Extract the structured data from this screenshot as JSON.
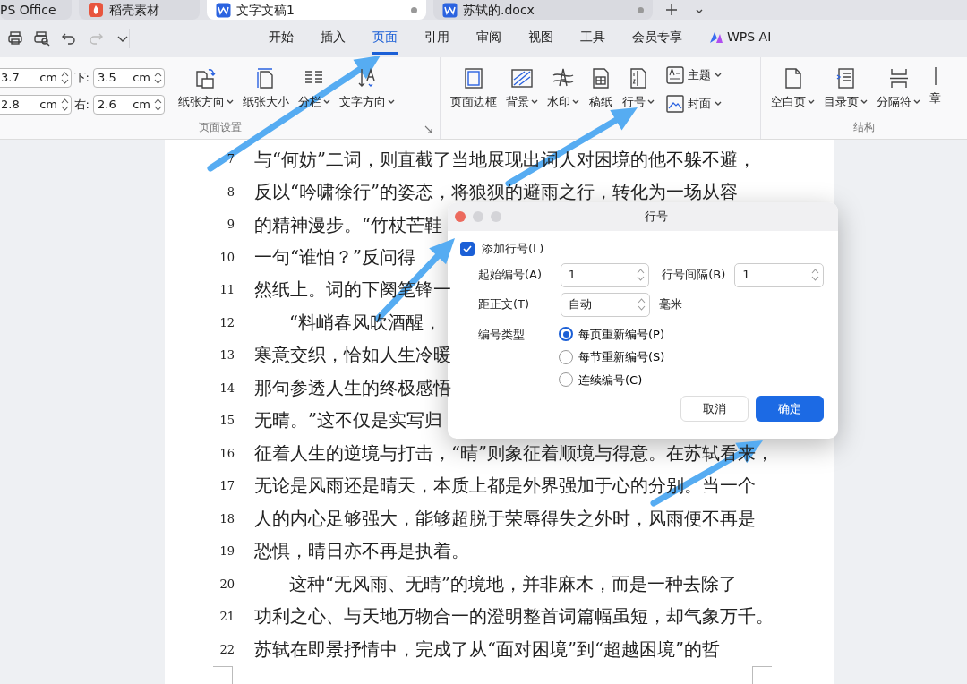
{
  "tabs": [
    {
      "label": "PS Office",
      "selected": false,
      "kind": "home",
      "modified": false
    },
    {
      "label": "稻壳素材",
      "selected": false,
      "kind": "docer",
      "modified": false
    },
    {
      "label": "文字文稿1",
      "selected": true,
      "kind": "doc",
      "modified": true
    },
    {
      "label": "苏轼的.docx",
      "selected": false,
      "kind": "doc",
      "modified": true
    }
  ],
  "quick_access": [
    {
      "kind": "print",
      "disabled": false
    },
    {
      "kind": "preview",
      "disabled": false
    },
    {
      "kind": "undo",
      "disabled": false
    },
    {
      "kind": "redo",
      "disabled": true
    },
    {
      "kind": "more",
      "disabled": false
    }
  ],
  "menu": [
    {
      "label": "开始",
      "selected": false
    },
    {
      "label": "插入",
      "selected": false
    },
    {
      "label": "页面",
      "selected": true
    },
    {
      "label": "引用",
      "selected": false
    },
    {
      "label": "审阅",
      "selected": false
    },
    {
      "label": "视图",
      "selected": false
    },
    {
      "label": "工具",
      "selected": false
    },
    {
      "label": "会员专享",
      "selected": false
    },
    {
      "label": "WPS AI",
      "selected": false,
      "kind": "ai"
    }
  ],
  "margins": [
    {
      "value": "3.7",
      "unit": "cm"
    },
    {
      "label": "下:",
      "value": "3.5",
      "unit": "cm"
    },
    {
      "value": "2.8",
      "unit": "cm"
    },
    {
      "label": "右:",
      "value": "2.6",
      "unit": "cm"
    }
  ],
  "ribbon_groups": [
    {
      "label": "页面设置",
      "launcher": true,
      "items": [
        {
          "label": "纸张方向",
          "dropdown": true
        },
        {
          "label": "纸张大小",
          "dropdown": false
        },
        {
          "label": "分栏",
          "dropdown": true
        },
        {
          "label": "文字方向",
          "dropdown": true
        }
      ]
    },
    {
      "items": [
        {
          "label": "页面边框",
          "dropdown": false
        },
        {
          "label": "背景",
          "dropdown": true
        },
        {
          "label": "水印",
          "dropdown": true
        },
        {
          "label": "稿纸",
          "dropdown": false
        },
        {
          "label": "行号",
          "dropdown": true
        },
        {
          "kind": "small",
          "label": "主题",
          "dropdown": true
        },
        {
          "kind": "small",
          "label": "封面",
          "dropdown": true
        }
      ]
    },
    {
      "label": "结构",
      "launcher": false,
      "items": [
        {
          "label": "空白页",
          "dropdown": true
        },
        {
          "label": "目录页",
          "dropdown": true
        },
        {
          "label": "分隔符",
          "dropdown": true
        },
        {
          "label": "章",
          "dropdown": false
        }
      ]
    }
  ],
  "document": {
    "lines": [
      {
        "number": "7",
        "text": "与“何妨”二词，则直截了当地展现出词人对困境的他不躲不避，",
        "indent": false
      },
      {
        "number": "8",
        "text": "反以“吟啸徐行”的姿态，将狼狈的避雨之行，转化为一场从容",
        "indent": false
      },
      {
        "number": "9",
        "text": "的精神漫步。“竹杖芒鞋",
        "indent": false
      },
      {
        "number": "10",
        "text": "一句“谁怕？”反问得",
        "indent": false
      },
      {
        "number": "11",
        "text": "然纸上。词的下阕笔锋一",
        "indent": false
      },
      {
        "number": "12",
        "text": "“料峭春风吹酒醒，",
        "indent": true
      },
      {
        "number": "13",
        "text": "寒意交织，恰如人生冷暖",
        "indent": false
      },
      {
        "number": "14",
        "text": "那句参透人生的终极感悟",
        "indent": false
      },
      {
        "number": "15",
        "text": "无晴。”这不仅是实写归",
        "indent": false
      },
      {
        "number": "16",
        "text": "征着人生的逆境与打击，“晴”则象征着顺境与得意。在苏轼看来，",
        "indent": false
      },
      {
        "number": "17",
        "text": "无论是风雨还是晴天，本质上都是外界强加于心的分别。当一个",
        "indent": false
      },
      {
        "number": "18",
        "text": "人的内心足够强大，能够超脱于荣辱得失之外时，风雨便不再是",
        "indent": false
      },
      {
        "number": "19",
        "text": "恐惧，晴日亦不再是执着。",
        "indent": false
      },
      {
        "number": "20",
        "text": "这种“无风雨、无晴”的境地，并非麻木，而是一种去除了",
        "indent": true
      },
      {
        "number": "21",
        "text": "功利之心、与天地万物合一的澄明整首词篇幅虽短，却气象万千。",
        "indent": false
      },
      {
        "number": "22",
        "text": "苏轼在即景抒情中，完成了从“面对困境”到“超越困境”的哲",
        "indent": false
      }
    ]
  },
  "dialog": {
    "title": "行号",
    "add_line_numbers": {
      "label": "添加行号(L)",
      "checked": true
    },
    "start": {
      "label": "起始编号(A)",
      "value": "1"
    },
    "interval": {
      "label": "行号间隔(B)",
      "value": "1"
    },
    "distance": {
      "label": "距正文(T)",
      "value": "自动",
      "unit": "毫米"
    },
    "numbering": {
      "label": "编号类型",
      "options": [
        {
          "label": "每页重新编号(P)",
          "selected": true
        },
        {
          "label": "每节重新编号(S)",
          "selected": false
        },
        {
          "label": "连续编号(C)",
          "selected": false
        }
      ]
    },
    "buttons": [
      {
        "label": "取消",
        "primary": false
      },
      {
        "label": "确定",
        "primary": true
      }
    ]
  }
}
